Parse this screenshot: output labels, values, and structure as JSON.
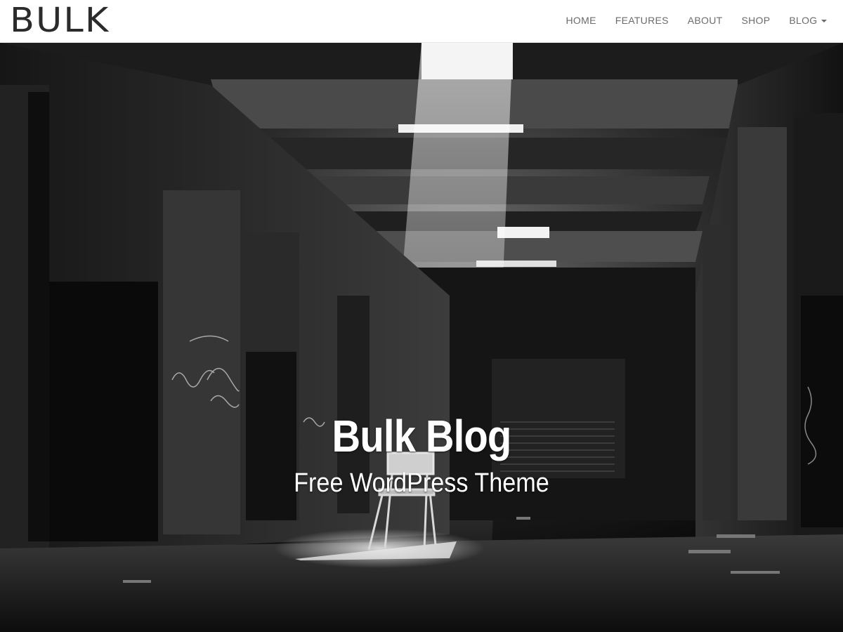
{
  "site": {
    "brand": "BULK"
  },
  "nav": {
    "items": [
      {
        "label": "HOME"
      },
      {
        "label": "FEATURES"
      },
      {
        "label": "ABOUT"
      },
      {
        "label": "SHOP"
      },
      {
        "label": "BLOG"
      }
    ],
    "dropdown_icon": "caret-down-icon"
  },
  "hero": {
    "title": "Bulk Blog",
    "subtitle": "Free WordPress Theme",
    "background_image": "abandoned-warehouse-with-chair"
  },
  "colors": {
    "nav_background": "#ffffff",
    "nav_text": "#6b6b6b",
    "brand_text": "#2b2b2b",
    "hero_text": "#ffffff"
  }
}
